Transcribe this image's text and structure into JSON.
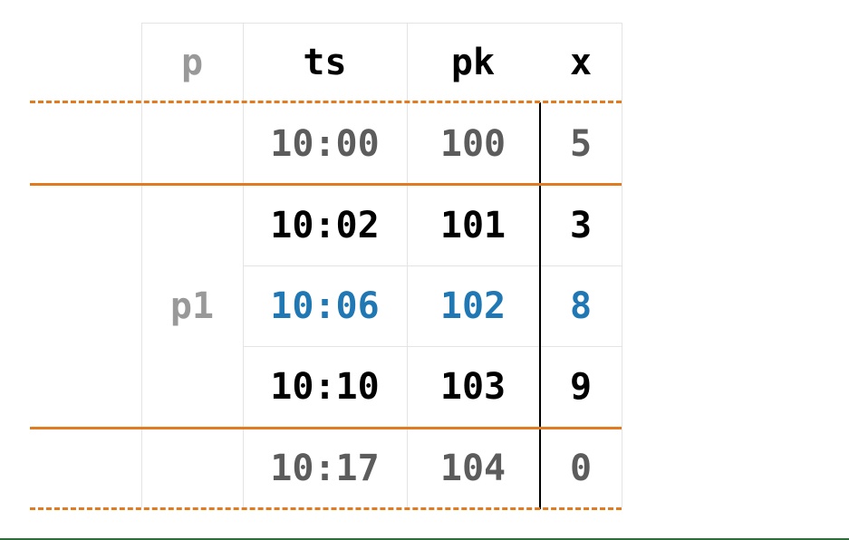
{
  "columns": [
    "p",
    "ts",
    "pk",
    "x"
  ],
  "partition_label": "p1",
  "rows": [
    {
      "ts": "10:00",
      "pk": "100",
      "x": "5",
      "style": "outside"
    },
    {
      "ts": "10:02",
      "pk": "101",
      "x": "3",
      "style": "normal"
    },
    {
      "ts": "10:06",
      "pk": "102",
      "x": "8",
      "style": "current"
    },
    {
      "ts": "10:10",
      "pk": "103",
      "x": "9",
      "style": "normal"
    },
    {
      "ts": "10:17",
      "pk": "104",
      "x": "0",
      "style": "outside"
    }
  ],
  "colors": {
    "accent": "#e07b1f",
    "current_row": "#1f77b4",
    "outside_row": "#5c5c5c",
    "normal_row": "#000000",
    "partition_text": "#999999",
    "header_text": "#000000",
    "gridline": "#e4e4e4"
  }
}
